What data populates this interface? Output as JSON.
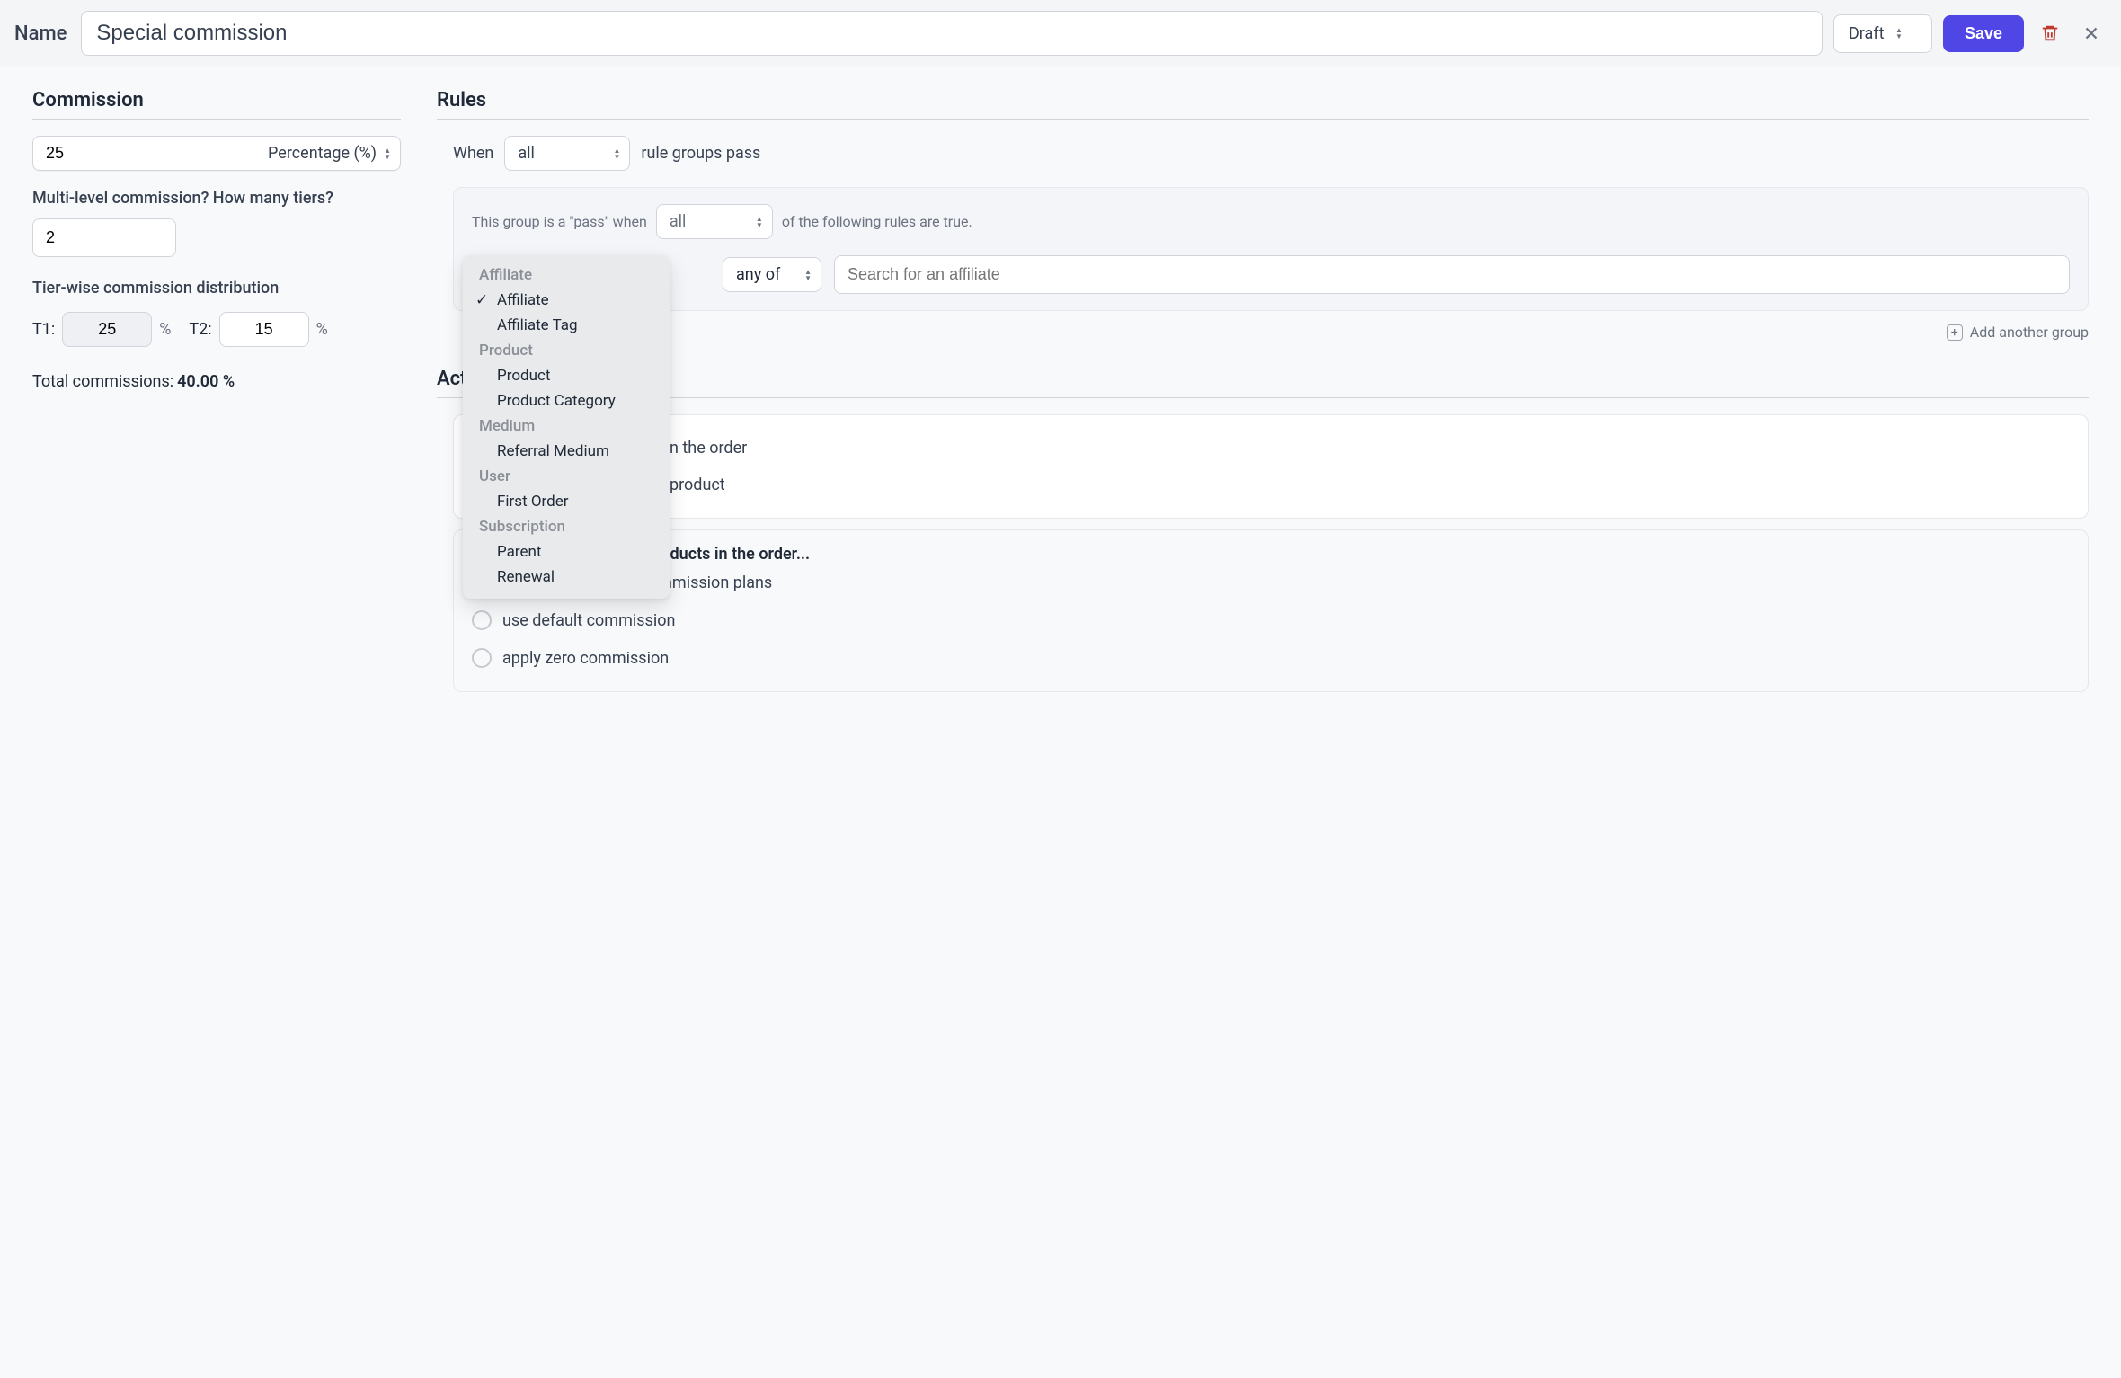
{
  "header": {
    "name_label": "Name",
    "name_value": "Special commission",
    "status": "Draft",
    "save_label": "Save"
  },
  "commission": {
    "title": "Commission",
    "value": "25",
    "type_label": "Percentage (%)",
    "tiers_question": "Multi-level commission? How many tiers?",
    "tiers_count": "2",
    "dist_label": "Tier-wise commission distribution",
    "t1_label": "T1:",
    "t1_value": "25",
    "t2_label": "T2:",
    "t2_value": "15",
    "pct": "%",
    "total_prefix": "Total commissions:",
    "total_value": "40.00 %"
  },
  "rules": {
    "title": "Rules",
    "when_prefix": "When",
    "when_scope": "all",
    "when_suffix": "rule groups pass",
    "group_prefix": "This group is a \"pass\" when",
    "group_scope": "all",
    "group_suffix": "of the following rules are true.",
    "rule_match": "any of",
    "search_placeholder": "Search for an affiliate",
    "add_group_label": "Add another group",
    "dropdown": {
      "groups": [
        {
          "label": "Affiliate",
          "items": [
            {
              "label": "Affiliate",
              "selected": true
            },
            {
              "label": "Affiliate Tag",
              "selected": false
            }
          ]
        },
        {
          "label": "Product",
          "items": [
            {
              "label": "Product",
              "selected": false
            },
            {
              "label": "Product Category",
              "selected": false
            }
          ]
        },
        {
          "label": "Medium",
          "items": [
            {
              "label": "Referral Medium",
              "selected": false
            }
          ]
        },
        {
          "label": "User",
          "items": [
            {
              "label": "First Order",
              "selected": false
            }
          ]
        },
        {
          "label": "Subscription",
          "items": [
            {
              "label": "Parent",
              "selected": false
            },
            {
              "label": "Renewal",
              "selected": false
            }
          ]
        }
      ]
    }
  },
  "actions": {
    "title": "Actions",
    "line1_suffix": "n the order",
    "line2_suffix": "product",
    "remaining_prefix": "And then, for remaining products in the order...",
    "opts": [
      {
        "label": "continue matching commission plans",
        "on": true
      },
      {
        "label": "use default commission",
        "on": false
      },
      {
        "label": "apply zero commission",
        "on": false
      }
    ]
  }
}
